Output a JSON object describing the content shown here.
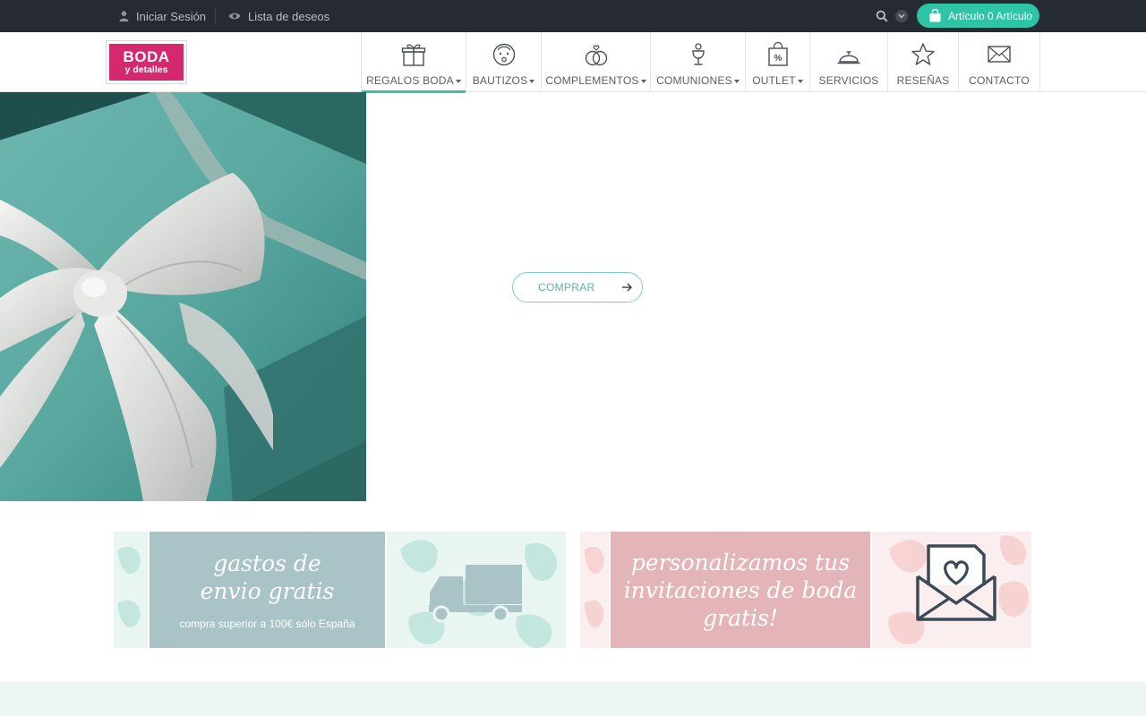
{
  "topbar": {
    "login_label": "Iniciar Sesión",
    "wishlist_label": "Lista de deseos",
    "cart_label": "Artículo 0 Artículo",
    "search_icon": "search-icon",
    "colors": {
      "background": "#262b33",
      "cart": "#2ec4a6"
    }
  },
  "brand": {
    "logo_line1": "BODA",
    "logo_line2": "y detalles",
    "color": "#d6286e"
  },
  "nav": {
    "items": [
      {
        "label": "REGALOS BODA",
        "icon": "gift-icon",
        "dropdown": true,
        "active": true
      },
      {
        "label": "BAUTIZOS",
        "icon": "baby-face-icon",
        "dropdown": true,
        "active": false
      },
      {
        "label": "COMPLEMENTOS",
        "icon": "rings-icon",
        "dropdown": true,
        "active": false
      },
      {
        "label": "COMUNIONES",
        "icon": "chalice-icon",
        "dropdown": true,
        "active": false
      },
      {
        "label": "OUTLET",
        "icon": "percent-bag-icon",
        "dropdown": true,
        "active": false
      },
      {
        "label": "SERVICIOS",
        "icon": "service-bell-icon",
        "dropdown": false,
        "active": false
      },
      {
        "label": "RESEÑAS",
        "icon": "star-icon",
        "dropdown": false,
        "active": false
      },
      {
        "label": "CONTACTO",
        "icon": "envelope-icon",
        "dropdown": false,
        "active": false
      }
    ],
    "accent": "#3cc0a8"
  },
  "hero": {
    "cta_label": "COMPRAR"
  },
  "banners": {
    "shipping": {
      "line1": "gastos de",
      "line2": "envio gratis",
      "sub": "compra superior a 100€ sólo España",
      "icon": "truck-icon"
    },
    "invitations": {
      "line1": "personalizamos tus",
      "line2": "invitaciones de boda",
      "line3": "gratis!",
      "icon": "envelope-heart-icon"
    }
  }
}
